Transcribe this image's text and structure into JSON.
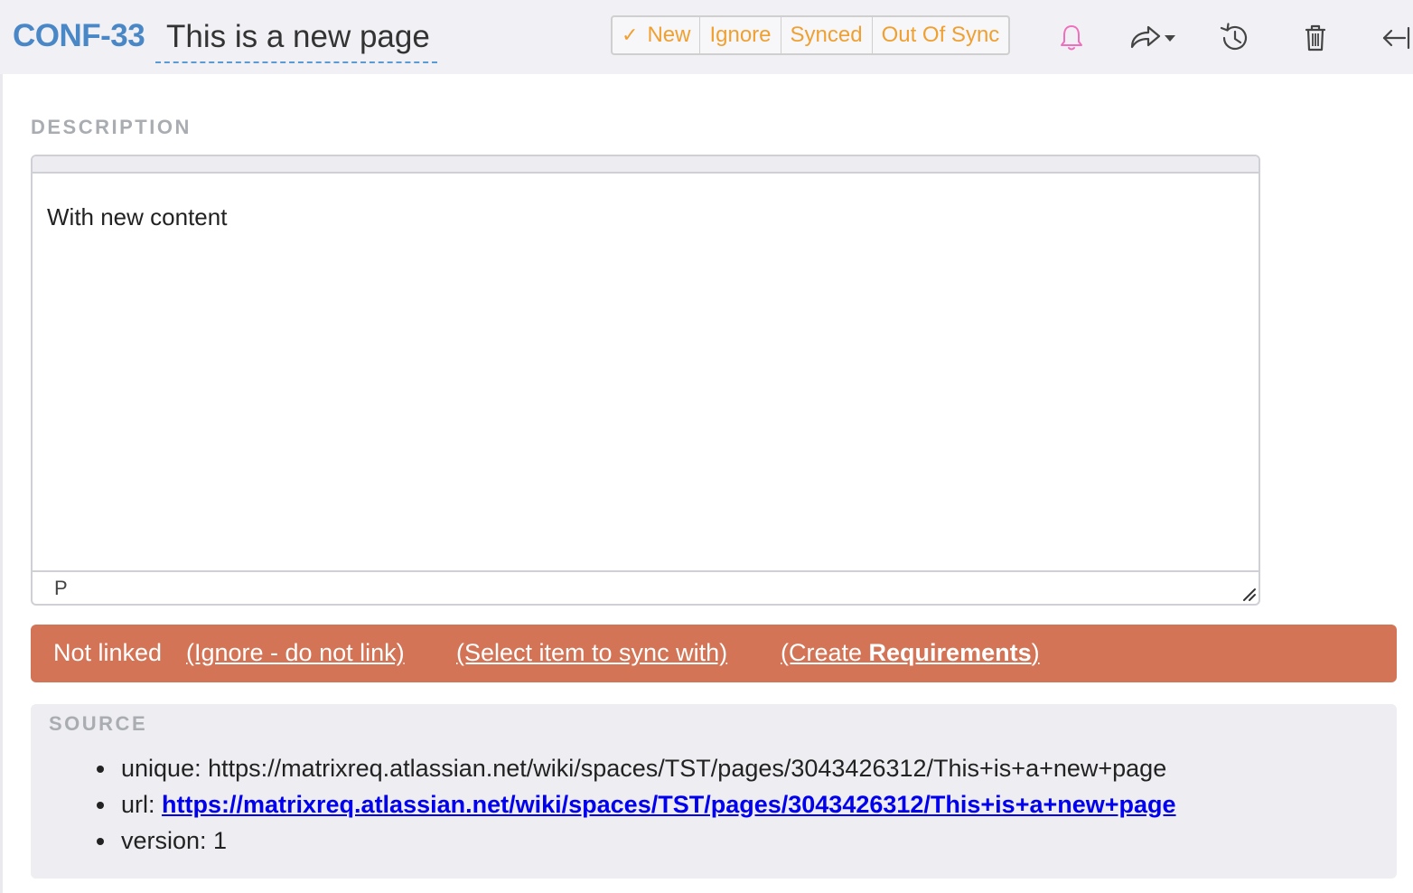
{
  "header": {
    "item_id": "CONF-33",
    "title": "This is a new page",
    "statuses": [
      {
        "label": "New",
        "selected": true
      },
      {
        "label": "Ignore",
        "selected": false
      },
      {
        "label": "Synced",
        "selected": false
      },
      {
        "label": "Out Of Sync",
        "selected": false
      }
    ],
    "check_glyph": "✓",
    "icons": [
      "bell-icon",
      "share-icon",
      "history-icon",
      "trash-icon",
      "collapse-left-icon"
    ]
  },
  "description": {
    "label": "DESCRIPTION",
    "content": "With new content",
    "path": "P"
  },
  "link_bar": {
    "status": "Not linked",
    "ignore_link": "(Ignore - do not link)",
    "select_link": "(Select item to sync with)",
    "create_prefix": "(Create ",
    "create_bold": "Requirements",
    "create_suffix": ")"
  },
  "source": {
    "label": "SOURCE",
    "unique_key": "unique: ",
    "unique_value": "https://matrixreq.atlassian.net/wiki/spaces/TST/pages/3043426312/This+is+a+new+page",
    "url_key": "url: ",
    "url_value": "https://matrixreq.atlassian.net/wiki/spaces/TST/pages/3043426312/This+is+a+new+page",
    "version_key": "version: ",
    "version_value": "1"
  },
  "colors": {
    "accent_blue": "#4a87c6",
    "status_orange": "#f0a030",
    "link_bar_bg": "#d47456",
    "bell_pink": "#f06fbd",
    "link_blue": "#0000ee"
  }
}
